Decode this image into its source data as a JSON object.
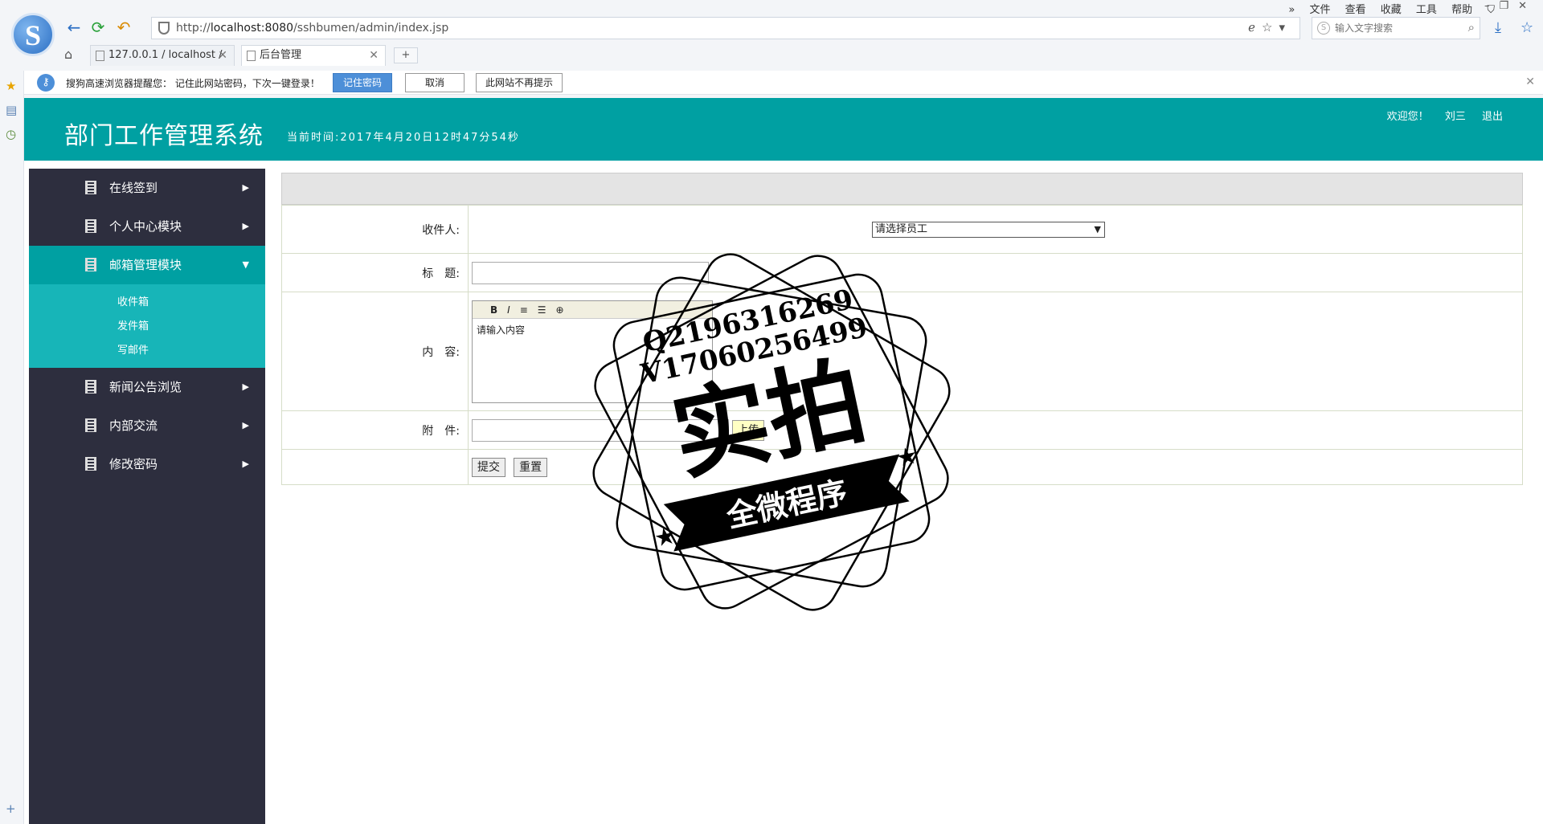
{
  "browser": {
    "url_prefix": "http://",
    "url_host": "localhost:8080",
    "url_path": "/sshbumen/admin/index.jsp",
    "search_placeholder": "输入文字搜索",
    "menu": [
      "文件",
      "查看",
      "收藏",
      "工具",
      "帮助"
    ],
    "tabs": [
      {
        "label": "127.0.0.1 / localhost /"
      },
      {
        "label": "后台管理"
      }
    ]
  },
  "notice": {
    "message": "搜狗高速浏览器提醒您：  记住此网站密码，下次一键登录！",
    "remember": "记住密码",
    "cancel": "取消",
    "never": "此网站不再提示"
  },
  "header": {
    "title": "部门工作管理系统",
    "time": "当前时间:2017年4月20日12时47分54秒",
    "welcome": "欢迎您！",
    "user": "刘三",
    "logout": "退出"
  },
  "sidebar": {
    "items": [
      {
        "label": "在线签到"
      },
      {
        "label": "个人中心模块"
      },
      {
        "label": "邮箱管理模块"
      },
      {
        "label": "新闻公告浏览"
      },
      {
        "label": "内部交流"
      },
      {
        "label": "修改密码"
      }
    ],
    "submenu": [
      "收件箱",
      "发件箱",
      "写邮件"
    ]
  },
  "form": {
    "recipient_label": "收件人:",
    "recipient_value": "请选择员工",
    "subject_label": "标　题:",
    "content_label": "内　容:",
    "content_value": "请输入内容",
    "attach_label": "附　件:",
    "upload": "上传",
    "submit": "提交",
    "reset": "重置"
  },
  "watermark": {
    "line1": "Q2196316269",
    "line2": "V17060256499",
    "main": "实拍",
    "banner": "全微程序"
  }
}
